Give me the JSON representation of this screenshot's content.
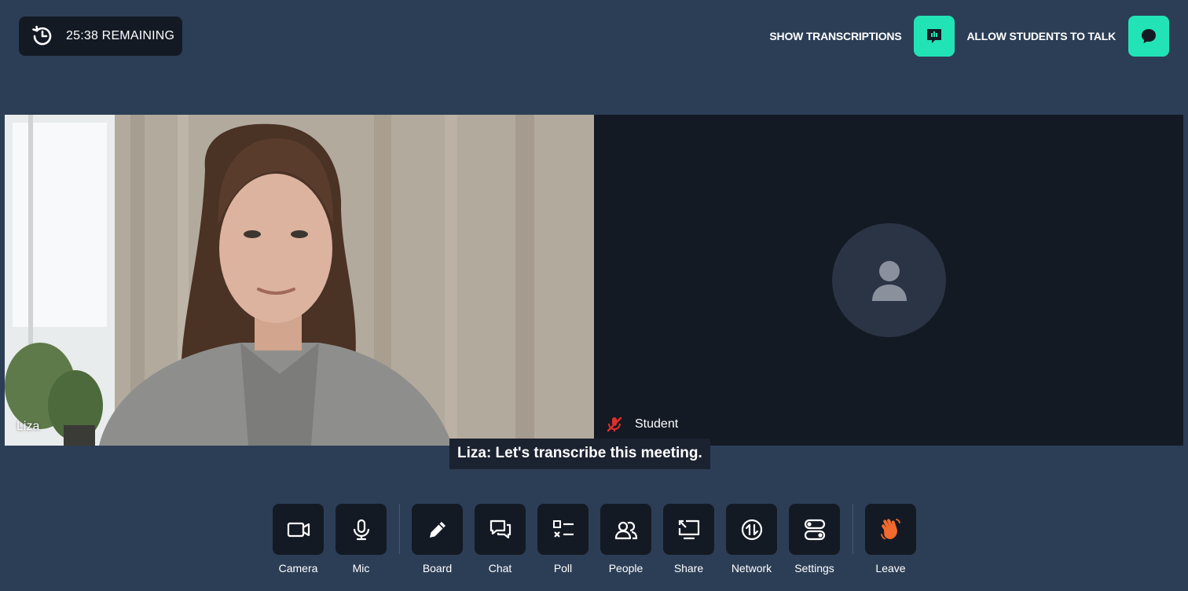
{
  "timer": {
    "text": "25:38 REMAINING"
  },
  "top_controls": {
    "transcriptions_label": "SHOW TRANSCRIPTIONS",
    "students_talk_label": "ALLOW STUDENTS TO TALK",
    "accent_color": "#22e3b5"
  },
  "participants": {
    "left": {
      "name": "Liza"
    },
    "right": {
      "name": "Student",
      "mic_status": "muted"
    }
  },
  "caption": {
    "text": "Liza: Let's transcribe this meeting."
  },
  "toolbar": {
    "camera": "Camera",
    "mic": "Mic",
    "board": "Board",
    "chat": "Chat",
    "poll": "Poll",
    "people": "People",
    "share": "Share",
    "network": "Network",
    "settings": "Settings",
    "leave": "Leave"
  },
  "colors": {
    "background": "#2c3e56",
    "panel": "#141a24",
    "leave_icon": "#f26a2e",
    "muted_icon": "#e0302c"
  }
}
